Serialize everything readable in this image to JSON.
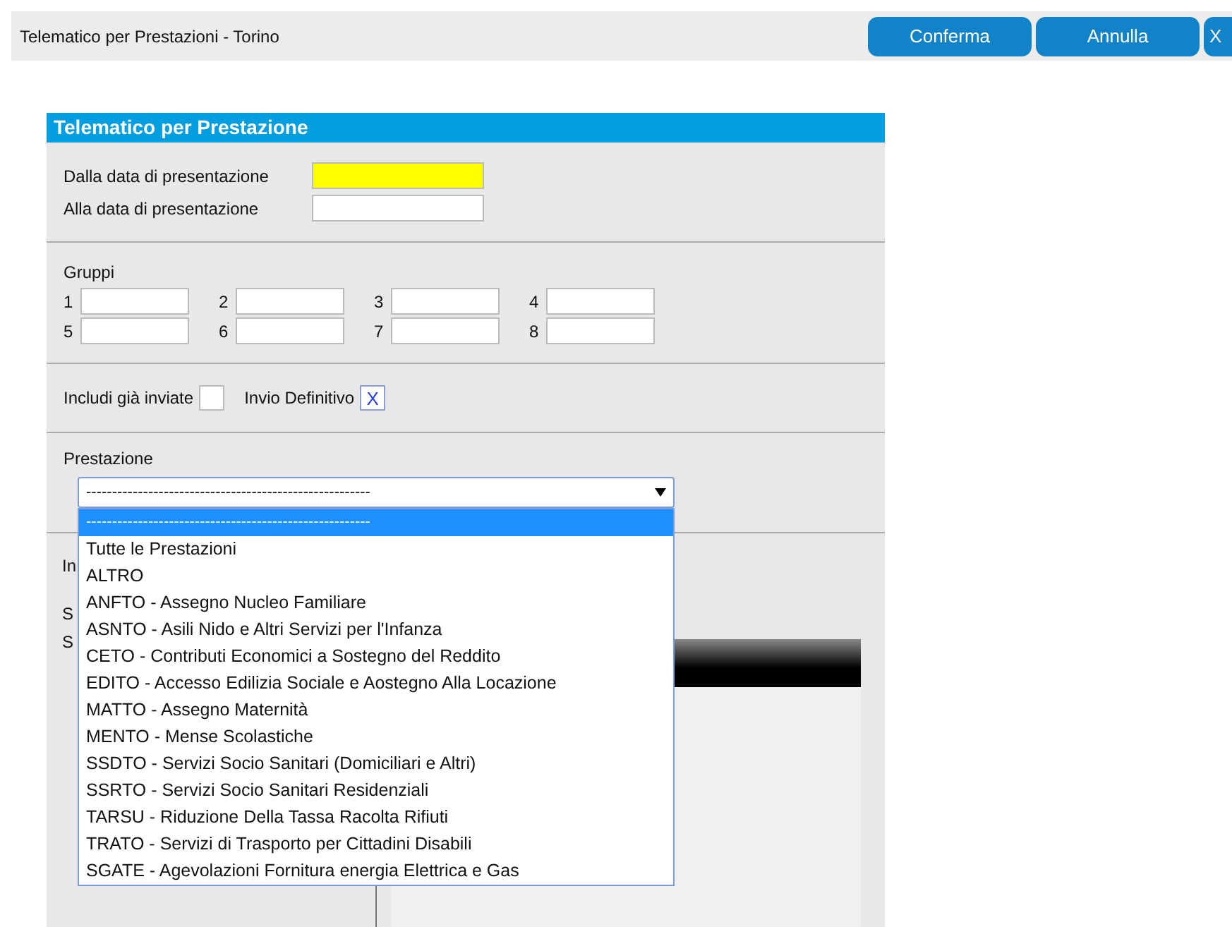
{
  "header": {
    "title": "Telematico per Prestazioni - Torino",
    "buttons": [
      "Conferma",
      "Annulla",
      "X"
    ]
  },
  "panel": {
    "title": "Telematico per Prestazione",
    "date_fields": [
      {
        "label": "Dalla data di presentazione",
        "highlighted": true
      },
      {
        "label": "Alla data di presentazione",
        "highlighted": false
      }
    ],
    "groups": {
      "label": "Gruppi",
      "fields": [
        "1",
        "2",
        "3",
        "4",
        "5",
        "6",
        "7",
        "8"
      ]
    },
    "checkboxes": [
      {
        "label": "Includi già inviate",
        "checked": false
      },
      {
        "label": "Invio Definitivo",
        "checked": true,
        "tick": "X"
      }
    ],
    "prestazione": {
      "label": "Prestazione",
      "value": "-------------------------------------------------------",
      "expanded": true,
      "options": [
        {
          "label": "-------------------------------------------------------",
          "selected": true
        },
        {
          "label": "Tutte le Prestazioni",
          "selected": false
        },
        {
          "label": "ALTRO",
          "selected": false
        },
        {
          "label": "ANFTO - Assegno Nucleo Familiare",
          "selected": false
        },
        {
          "label": "ASNTO - Asili Nido e Altri Servizi per l'Infanza",
          "selected": false
        },
        {
          "label": "CETO - Contributi Economici a Sostegno del Reddito",
          "selected": false
        },
        {
          "label": "EDITO - Accesso Edilizia Sociale e Aostegno Alla Locazione",
          "selected": false
        },
        {
          "label": "MATTO - Assegno Maternità",
          "selected": false
        },
        {
          "label": "MENTO - Mense Scolastiche",
          "selected": false
        },
        {
          "label": "SSDTO - Servizi Socio Sanitari (Domiciliari e Altri)",
          "selected": false
        },
        {
          "label": "SSRTO - Servizi Socio Sanitari Residenziali",
          "selected": false
        },
        {
          "label": "TARSU - Riduzione Della Tassa Racolta Rifiuti",
          "selected": false
        },
        {
          "label": "TRATO - Servizi di Trasporto per Cittadini Disabili",
          "selected": false
        },
        {
          "label": "SGATE - Agevolazioni Fornitura energia Elettrica e Gas",
          "selected": false
        }
      ]
    },
    "hidden_labels": [
      "In",
      "S",
      "S"
    ]
  }
}
